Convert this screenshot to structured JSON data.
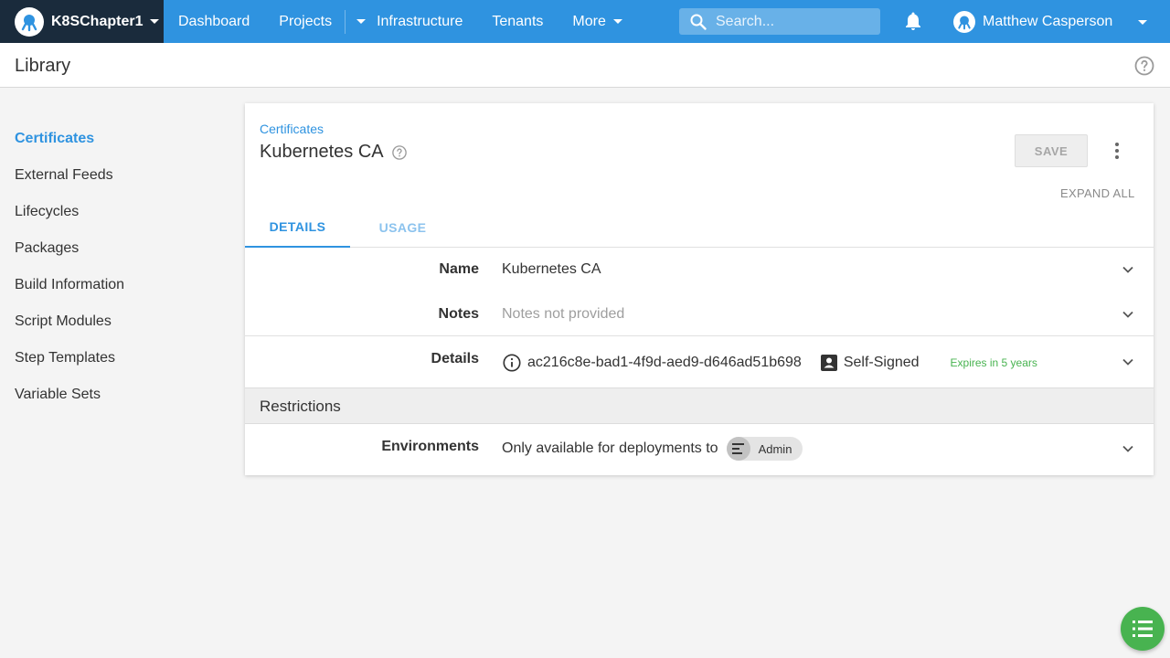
{
  "nav": {
    "space_name": "K8SChapter1",
    "links": {
      "dashboard": "Dashboard",
      "projects": "Projects",
      "infrastructure": "Infrastructure",
      "tenants": "Tenants",
      "more": "More"
    },
    "search_placeholder": "Search...",
    "user_name": "Matthew Casperson"
  },
  "header": {
    "title": "Library"
  },
  "sidebar": {
    "items": [
      {
        "label": "Certificates",
        "active": true
      },
      {
        "label": "External Feeds"
      },
      {
        "label": "Lifecycles"
      },
      {
        "label": "Packages"
      },
      {
        "label": "Build Information"
      },
      {
        "label": "Script Modules"
      },
      {
        "label": "Step Templates"
      },
      {
        "label": "Variable Sets"
      }
    ]
  },
  "card": {
    "breadcrumb": "Certificates",
    "title": "Kubernetes CA",
    "save_label": "SAVE",
    "expand_all_label": "EXPAND ALL",
    "tabs": {
      "details": "DETAILS",
      "usage": "USAGE"
    },
    "rows": {
      "name": {
        "label": "Name",
        "value": "Kubernetes CA"
      },
      "notes": {
        "label": "Notes",
        "value": "Notes not provided"
      },
      "details": {
        "label": "Details",
        "thumbprint": "ac216c8e-bad1-4f9d-aed9-d646ad51b698",
        "signing": "Self-Signed",
        "expiry": "Expires in 5 years"
      },
      "environments": {
        "label": "Environments",
        "prefix": "Only available for deployments to",
        "environment": "Admin"
      }
    },
    "restrictions_title": "Restrictions"
  },
  "colors": {
    "nav_blue": "#2f93e0",
    "space_dark": "#1a2b3c",
    "expiry_green": "#48b350",
    "fab_green": "#48b350"
  }
}
